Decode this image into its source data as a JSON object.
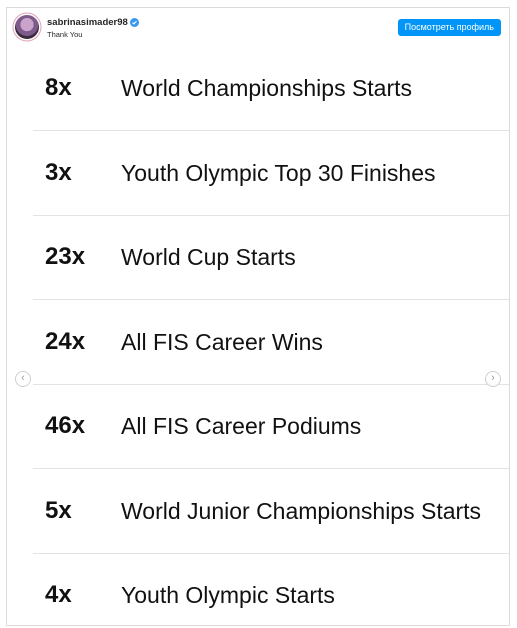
{
  "post": {
    "username": "sabrinasimader98",
    "subtitle": "Thank You",
    "view_profile_label": "Посмотреть профиль"
  },
  "stats": [
    {
      "multiplier": "8x",
      "label": "World Championships Starts"
    },
    {
      "multiplier": "3x",
      "label": "Youth Olympic Top 30 Finishes"
    },
    {
      "multiplier": "23x",
      "label": "World Cup Starts"
    },
    {
      "multiplier": "24x",
      "label": "All FIS Career Wins"
    },
    {
      "multiplier": "46x",
      "label": "All FIS Career Podiums"
    },
    {
      "multiplier": "5x",
      "label": "World Junior Championships Starts"
    },
    {
      "multiplier": "4x",
      "label": "Youth Olympic Starts"
    }
  ],
  "nav": {
    "prev_icon": "‹",
    "next_icon": "›"
  },
  "colors": {
    "button": "#0095f6",
    "verified": "#3897f0",
    "text": "#111111"
  }
}
